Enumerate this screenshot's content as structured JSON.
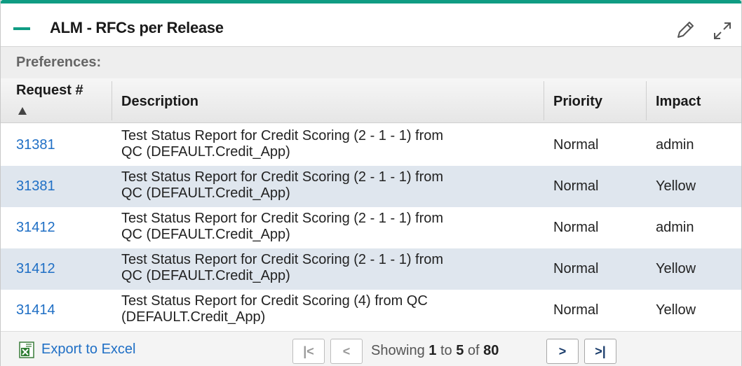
{
  "portlet": {
    "title": "ALM - RFCs per Release",
    "accent_color": "#0f9c83"
  },
  "preferences": {
    "label": "Preferences:"
  },
  "table": {
    "columns": [
      {
        "label": "Request #",
        "sort": "ascending"
      },
      {
        "label": "Description"
      },
      {
        "label": "Priority"
      },
      {
        "label": "Impact"
      }
    ],
    "rows": [
      {
        "request": "31381",
        "desc_line1": "Test Status Report for Credit Scoring (2 - 1 - 1) from",
        "desc_line2": "QC (DEFAULT.Credit_App)",
        "priority": "Normal",
        "impact": "admin"
      },
      {
        "request": "31381",
        "desc_line1": "Test Status Report for Credit Scoring (2 - 1 - 1) from",
        "desc_line2": "QC (DEFAULT.Credit_App)",
        "priority": "Normal",
        "impact": "Yellow"
      },
      {
        "request": "31412",
        "desc_line1": "Test Status Report for Credit Scoring (2 - 1 - 1) from",
        "desc_line2": "QC (DEFAULT.Credit_App)",
        "priority": "Normal",
        "impact": "admin"
      },
      {
        "request": "31412",
        "desc_line1": "Test Status Report for Credit Scoring (2 - 1 - 1) from",
        "desc_line2": "QC (DEFAULT.Credit_App)",
        "priority": "Normal",
        "impact": "Yellow"
      },
      {
        "request": "31414",
        "desc_line1": "Test Status Report for Credit Scoring (4) from QC",
        "desc_line2": "(DEFAULT.Credit_App)",
        "priority": "Normal",
        "impact": "Yellow"
      }
    ]
  },
  "footer": {
    "export_label": "Export to Excel",
    "paging": {
      "prefix": "Showing",
      "from": "1",
      "to_word": "to",
      "to": "5",
      "of_word": "of",
      "total": "80",
      "first_glyph": "|<",
      "prev_glyph": "<",
      "next_glyph": ">",
      "last_glyph": ">|"
    }
  }
}
